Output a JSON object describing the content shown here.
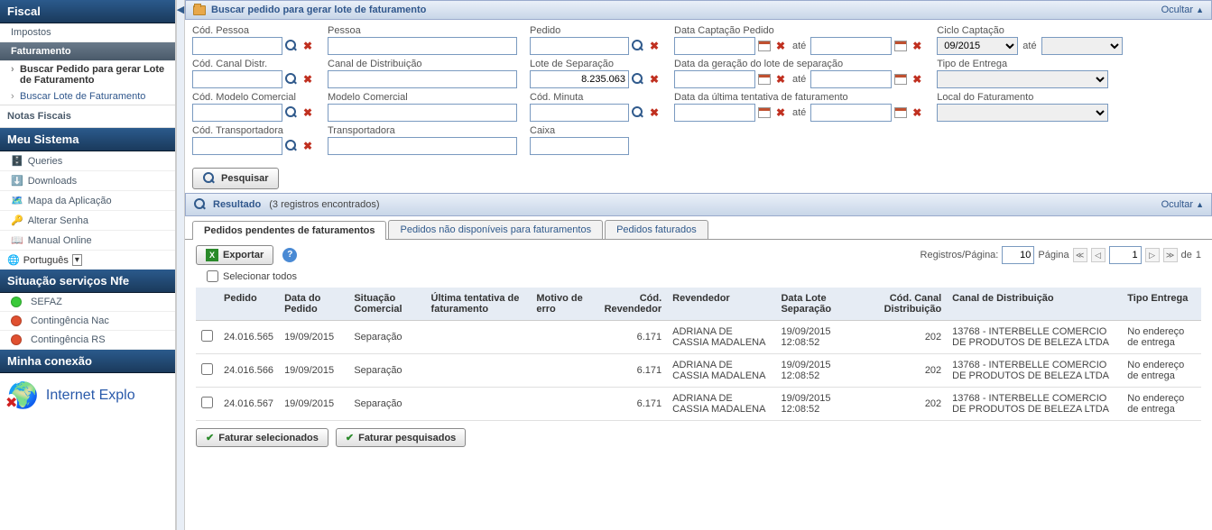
{
  "sidebar": {
    "fiscal_header": "Fiscal",
    "impostos": "Impostos",
    "faturamento": "Faturamento",
    "sub1": "Buscar Pedido para gerar Lote de Faturamento",
    "sub2": "Buscar Lote de Faturamento",
    "notas_fiscais": "Notas Fiscais",
    "meu_sistema": "Meu Sistema",
    "queries": "Queries",
    "downloads": "Downloads",
    "mapa": "Mapa da Aplicação",
    "alterar_senha": "Alterar Senha",
    "manual": "Manual Online",
    "lang": "Português",
    "nfe_header": "Situação serviços Nfe",
    "sefaz": "SEFAZ",
    "cont_nac": "Contingência Nac",
    "cont_rs": "Contingência RS",
    "conn_header": "Minha conexão",
    "conn_text": "Internet Explo"
  },
  "search_panel": {
    "title": "Buscar pedido para gerar lote de faturamento",
    "ocultar": "Ocultar",
    "labels": {
      "cod_pessoa": "Cód. Pessoa",
      "pessoa": "Pessoa",
      "pedido": "Pedido",
      "data_capt": "Data Captação Pedido",
      "ciclo": "Ciclo Captação",
      "cod_canal": "Cód. Canal Distr.",
      "canal": "Canal de Distribuição",
      "lote_sep": "Lote de Separação",
      "data_ger": "Data da geração do lote de separação",
      "tipo_entrega": "Tipo de Entrega",
      "cod_modelo": "Cód. Modelo Comercial",
      "modelo": "Modelo Comercial",
      "cod_minuta": "Cód. Minuta",
      "data_ult": "Data da última tentativa de faturamento",
      "local_fat": "Local do Faturamento",
      "cod_transp": "Cód. Transportadora",
      "transp": "Transportadora",
      "caixa": "Caixa",
      "ate": "até"
    },
    "values": {
      "lote_sep": "8.235.063",
      "ciclo": "09/2015"
    },
    "pesquisar": "Pesquisar"
  },
  "result_panel": {
    "title": "Resultado",
    "count_text": "(3 registros encontrados)",
    "ocultar": "Ocultar",
    "tabs": {
      "t1": "Pedidos pendentes de faturamentos",
      "t2": "Pedidos não disponíveis para faturamentos",
      "t3": "Pedidos faturados"
    },
    "exportar": "Exportar",
    "sel_todos": "Selecionar todos",
    "pager": {
      "reg_label": "Registros/Página:",
      "reg_val": "10",
      "pag_label": "Página",
      "pag_val": "1",
      "de": "de",
      "total": "1"
    },
    "columns": {
      "pedido": "Pedido",
      "data_pedido": "Data do Pedido",
      "sit_com": "Situação Comercial",
      "ult_tent": "Última tentativa de faturamento",
      "motivo": "Motivo de erro",
      "cod_rev": "Cód. Revendedor",
      "revendedor": "Revendedor",
      "data_lote": "Data Lote Separação",
      "cod_canal": "Cód. Canal Distribuição",
      "canal": "Canal de Distribuição",
      "tipo_ent": "Tipo Entrega"
    },
    "rows": [
      {
        "pedido": "24.016.565",
        "data": "19/09/2015",
        "sit": "Separação",
        "ult": "",
        "motivo": "",
        "cod_rev": "6.171",
        "rev": "ADRIANA DE CASSIA MADALENA",
        "data_lote": "19/09/2015 12:08:52",
        "cod_canal": "202",
        "canal": "13768 - INTERBELLE COMERCIO DE PRODUTOS DE BELEZA LTDA",
        "tipo": "No endereço de entrega"
      },
      {
        "pedido": "24.016.566",
        "data": "19/09/2015",
        "sit": "Separação",
        "ult": "",
        "motivo": "",
        "cod_rev": "6.171",
        "rev": "ADRIANA DE CASSIA MADALENA",
        "data_lote": "19/09/2015 12:08:52",
        "cod_canal": "202",
        "canal": "13768 - INTERBELLE COMERCIO DE PRODUTOS DE BELEZA LTDA",
        "tipo": "No endereço de entrega"
      },
      {
        "pedido": "24.016.567",
        "data": "19/09/2015",
        "sit": "Separação",
        "ult": "",
        "motivo": "",
        "cod_rev": "6.171",
        "rev": "ADRIANA DE CASSIA MADALENA",
        "data_lote": "19/09/2015 12:08:52",
        "cod_canal": "202",
        "canal": "13768 - INTERBELLE COMERCIO DE PRODUTOS DE BELEZA LTDA",
        "tipo": "No endereço de entrega"
      }
    ],
    "fat_sel": "Faturar selecionados",
    "fat_pesq": "Faturar pesquisados"
  }
}
